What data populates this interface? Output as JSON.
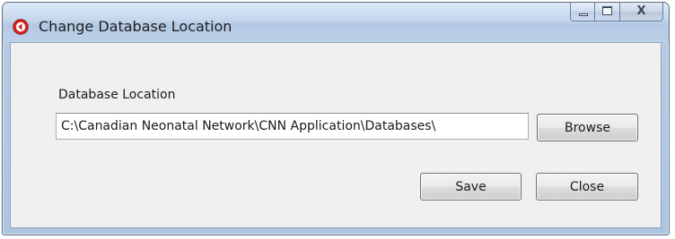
{
  "window": {
    "title": "Change Database Location",
    "icon": "app-logo-icon",
    "controls": {
      "minimize": "minimize-icon",
      "maximize": "maximize-icon",
      "close_glyph": "X"
    }
  },
  "form": {
    "database_location_label": "Database Location",
    "database_location_value": "C:\\Canadian Neonatal Network\\CNN Application\\Databases\\"
  },
  "buttons": {
    "browse": "Browse",
    "save": "Save",
    "close": "Close"
  },
  "colors": {
    "accent": "#d7261e",
    "titlebar": "#c4d6ec",
    "client_background": "#f0f0f0"
  }
}
